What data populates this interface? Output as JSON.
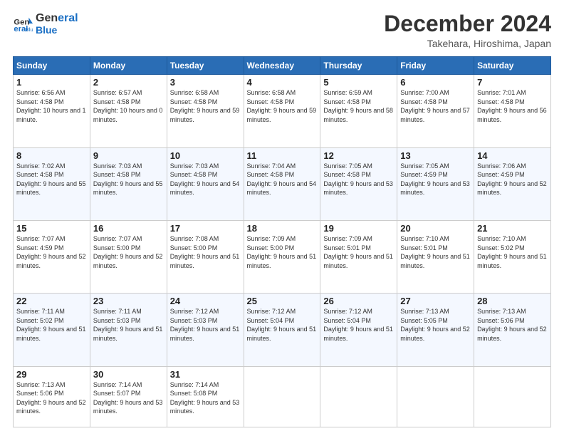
{
  "header": {
    "logo_line1": "General",
    "logo_line2": "Blue",
    "month": "December 2024",
    "location": "Takehara, Hiroshima, Japan"
  },
  "days_of_week": [
    "Sunday",
    "Monday",
    "Tuesday",
    "Wednesday",
    "Thursday",
    "Friday",
    "Saturday"
  ],
  "weeks": [
    [
      {
        "day": 1,
        "sunrise": "6:56 AM",
        "sunset": "4:58 PM",
        "daylight": "10 hours and 1 minute."
      },
      {
        "day": 2,
        "sunrise": "6:57 AM",
        "sunset": "4:58 PM",
        "daylight": "10 hours and 0 minutes."
      },
      {
        "day": 3,
        "sunrise": "6:58 AM",
        "sunset": "4:58 PM",
        "daylight": "9 hours and 59 minutes."
      },
      {
        "day": 4,
        "sunrise": "6:58 AM",
        "sunset": "4:58 PM",
        "daylight": "9 hours and 59 minutes."
      },
      {
        "day": 5,
        "sunrise": "6:59 AM",
        "sunset": "4:58 PM",
        "daylight": "9 hours and 58 minutes."
      },
      {
        "day": 6,
        "sunrise": "7:00 AM",
        "sunset": "4:58 PM",
        "daylight": "9 hours and 57 minutes."
      },
      {
        "day": 7,
        "sunrise": "7:01 AM",
        "sunset": "4:58 PM",
        "daylight": "9 hours and 56 minutes."
      }
    ],
    [
      {
        "day": 8,
        "sunrise": "7:02 AM",
        "sunset": "4:58 PM",
        "daylight": "9 hours and 55 minutes."
      },
      {
        "day": 9,
        "sunrise": "7:03 AM",
        "sunset": "4:58 PM",
        "daylight": "9 hours and 55 minutes."
      },
      {
        "day": 10,
        "sunrise": "7:03 AM",
        "sunset": "4:58 PM",
        "daylight": "9 hours and 54 minutes."
      },
      {
        "day": 11,
        "sunrise": "7:04 AM",
        "sunset": "4:58 PM",
        "daylight": "9 hours and 54 minutes."
      },
      {
        "day": 12,
        "sunrise": "7:05 AM",
        "sunset": "4:58 PM",
        "daylight": "9 hours and 53 minutes."
      },
      {
        "day": 13,
        "sunrise": "7:05 AM",
        "sunset": "4:59 PM",
        "daylight": "9 hours and 53 minutes."
      },
      {
        "day": 14,
        "sunrise": "7:06 AM",
        "sunset": "4:59 PM",
        "daylight": "9 hours and 52 minutes."
      }
    ],
    [
      {
        "day": 15,
        "sunrise": "7:07 AM",
        "sunset": "4:59 PM",
        "daylight": "9 hours and 52 minutes."
      },
      {
        "day": 16,
        "sunrise": "7:07 AM",
        "sunset": "5:00 PM",
        "daylight": "9 hours and 52 minutes."
      },
      {
        "day": 17,
        "sunrise": "7:08 AM",
        "sunset": "5:00 PM",
        "daylight": "9 hours and 51 minutes."
      },
      {
        "day": 18,
        "sunrise": "7:09 AM",
        "sunset": "5:00 PM",
        "daylight": "9 hours and 51 minutes."
      },
      {
        "day": 19,
        "sunrise": "7:09 AM",
        "sunset": "5:01 PM",
        "daylight": "9 hours and 51 minutes."
      },
      {
        "day": 20,
        "sunrise": "7:10 AM",
        "sunset": "5:01 PM",
        "daylight": "9 hours and 51 minutes."
      },
      {
        "day": 21,
        "sunrise": "7:10 AM",
        "sunset": "5:02 PM",
        "daylight": "9 hours and 51 minutes."
      }
    ],
    [
      {
        "day": 22,
        "sunrise": "7:11 AM",
        "sunset": "5:02 PM",
        "daylight": "9 hours and 51 minutes."
      },
      {
        "day": 23,
        "sunrise": "7:11 AM",
        "sunset": "5:03 PM",
        "daylight": "9 hours and 51 minutes."
      },
      {
        "day": 24,
        "sunrise": "7:12 AM",
        "sunset": "5:03 PM",
        "daylight": "9 hours and 51 minutes."
      },
      {
        "day": 25,
        "sunrise": "7:12 AM",
        "sunset": "5:04 PM",
        "daylight": "9 hours and 51 minutes."
      },
      {
        "day": 26,
        "sunrise": "7:12 AM",
        "sunset": "5:04 PM",
        "daylight": "9 hours and 51 minutes."
      },
      {
        "day": 27,
        "sunrise": "7:13 AM",
        "sunset": "5:05 PM",
        "daylight": "9 hours and 52 minutes."
      },
      {
        "day": 28,
        "sunrise": "7:13 AM",
        "sunset": "5:06 PM",
        "daylight": "9 hours and 52 minutes."
      }
    ],
    [
      {
        "day": 29,
        "sunrise": "7:13 AM",
        "sunset": "5:06 PM",
        "daylight": "9 hours and 52 minutes."
      },
      {
        "day": 30,
        "sunrise": "7:14 AM",
        "sunset": "5:07 PM",
        "daylight": "9 hours and 53 minutes."
      },
      {
        "day": 31,
        "sunrise": "7:14 AM",
        "sunset": "5:08 PM",
        "daylight": "9 hours and 53 minutes."
      },
      null,
      null,
      null,
      null
    ]
  ]
}
